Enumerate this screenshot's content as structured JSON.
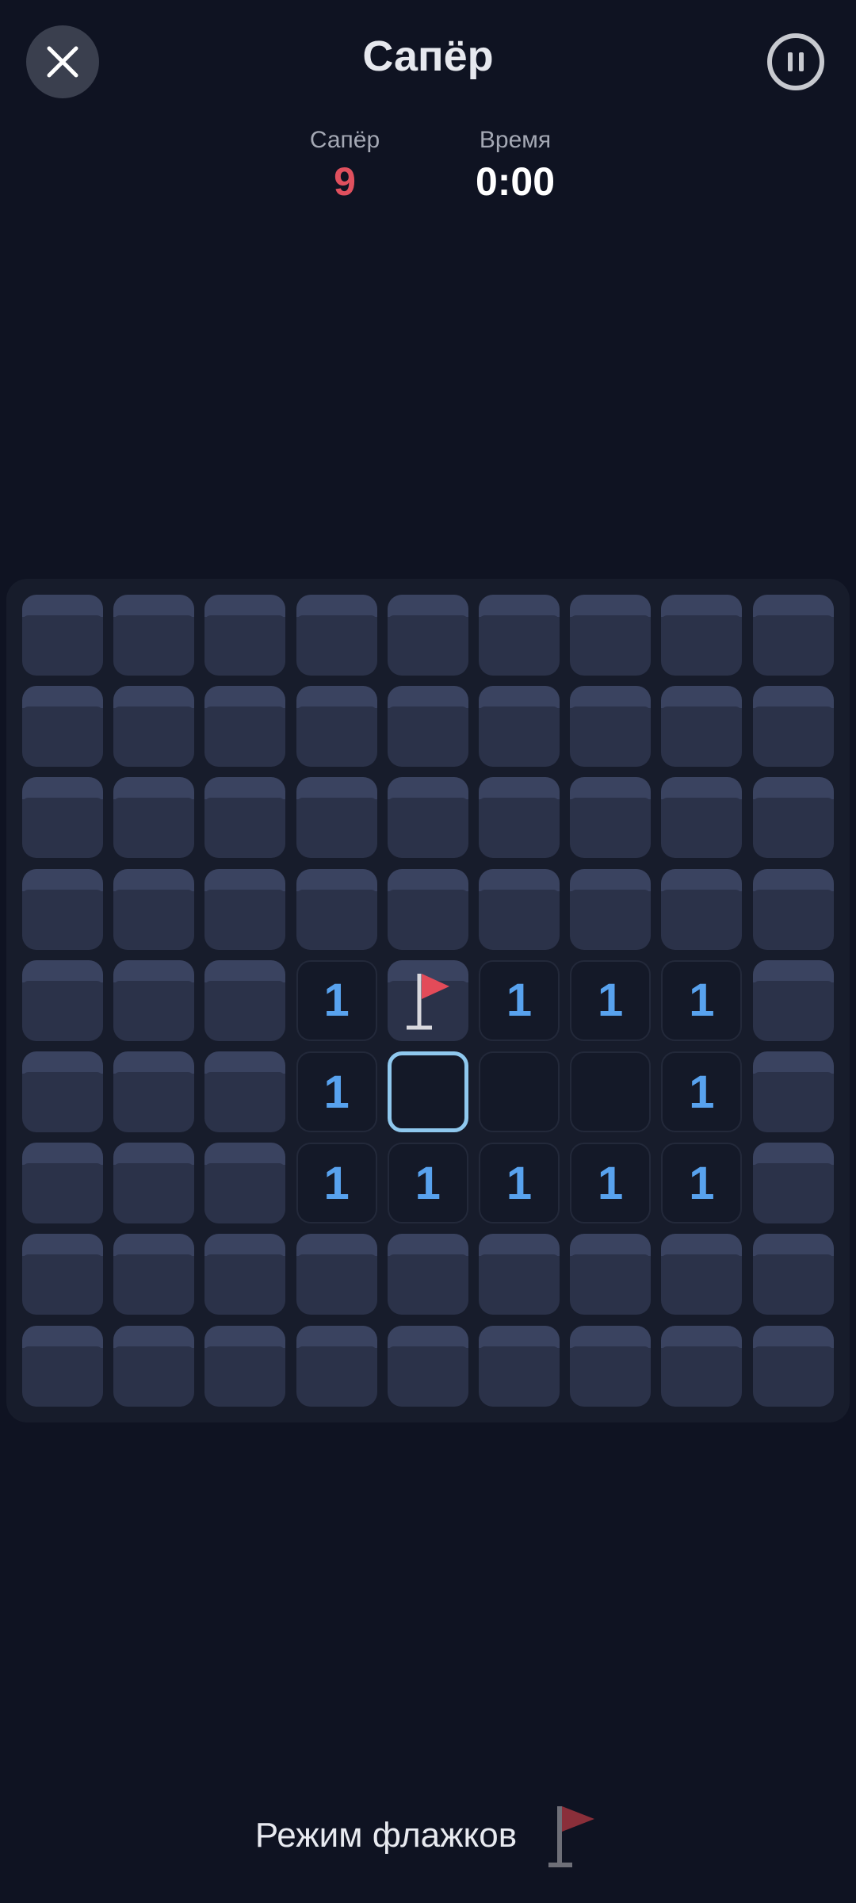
{
  "header": {
    "title": "Сапёр",
    "close_icon": "close-icon",
    "pause_icon": "pause-icon"
  },
  "stats": {
    "mines_label": "Сапёр",
    "mines_value": "9",
    "time_label": "Время",
    "time_value": "0:00"
  },
  "board": {
    "size": 9,
    "rows": [
      [
        "closed",
        "closed",
        "closed",
        "closed",
        "closed",
        "closed",
        "closed",
        "closed",
        "closed"
      ],
      [
        "closed",
        "closed",
        "closed",
        "closed",
        "closed",
        "closed",
        "closed",
        "closed",
        "closed"
      ],
      [
        "closed",
        "closed",
        "closed",
        "closed",
        "closed",
        "closed",
        "closed",
        "closed",
        "closed"
      ],
      [
        "closed",
        "closed",
        "closed",
        "closed",
        "closed",
        "closed",
        "closed",
        "closed",
        "closed"
      ],
      [
        "closed",
        "closed",
        "closed",
        "1",
        "flag",
        "1",
        "1",
        "1",
        "closed"
      ],
      [
        "closed",
        "closed",
        "closed",
        "1",
        "selected",
        "empty",
        "empty",
        "1",
        "closed"
      ],
      [
        "closed",
        "closed",
        "closed",
        "1",
        "1",
        "1",
        "1",
        "1",
        "closed"
      ],
      [
        "closed",
        "closed",
        "closed",
        "closed",
        "closed",
        "closed",
        "closed",
        "closed",
        "closed"
      ],
      [
        "closed",
        "closed",
        "closed",
        "closed",
        "closed",
        "closed",
        "closed",
        "closed",
        "closed"
      ]
    ]
  },
  "footer": {
    "flag_mode_label": "Режим флажков",
    "flag_icon": "flag-icon"
  },
  "colors": {
    "background": "#0f1322",
    "mines_value": "#e0505e",
    "number": "#58a2ee",
    "selected_border": "#8fc8ee",
    "flag": "#e34b59"
  }
}
